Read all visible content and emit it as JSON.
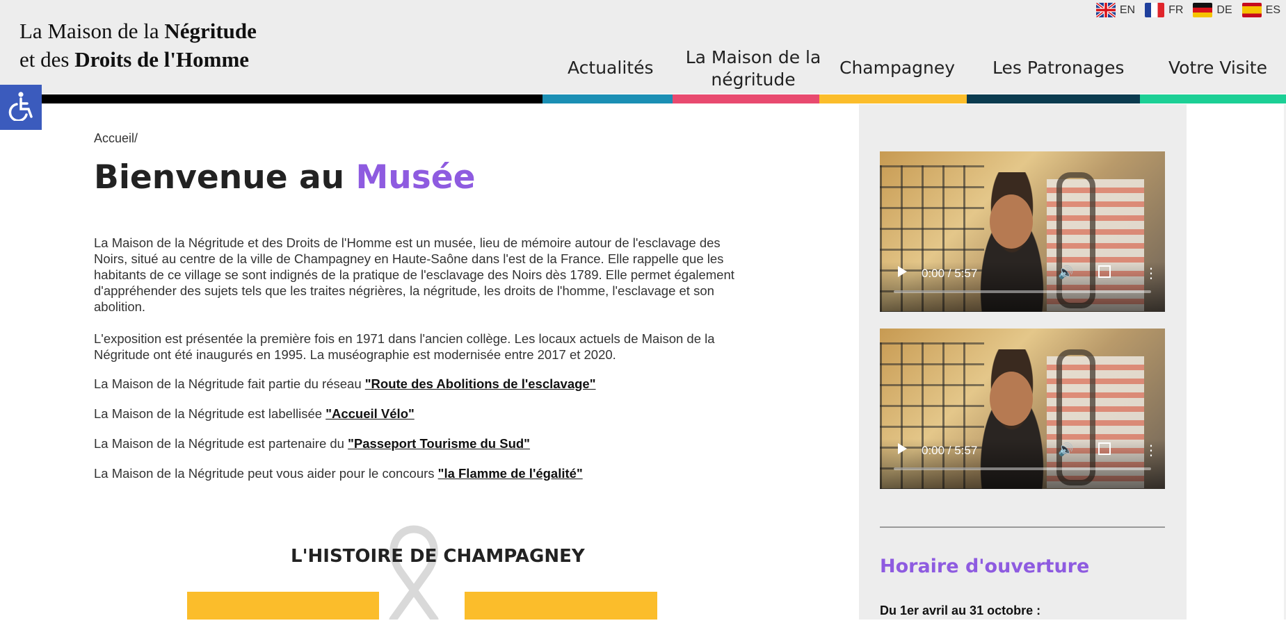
{
  "header": {
    "title_line1_plain": "La Maison de la ",
    "title_line1_bold": "Négritude",
    "title_line2_plain": "et des ",
    "title_line2_bold": "Droits de l'Homme",
    "languages": [
      {
        "code": "EN",
        "flag": "uk-flag-icon"
      },
      {
        "code": "FR",
        "flag": "france-flag-icon"
      },
      {
        "code": "DE",
        "flag": "germany-flag-icon"
      },
      {
        "code": "ES",
        "flag": "spain-flag-icon"
      }
    ],
    "nav": {
      "actualites": "Actualités",
      "maison_line1": "La Maison de la",
      "maison_line2": "négritude",
      "champagney": "Champagney",
      "patronages": "Les Patronages",
      "visite": "Votre Visite"
    },
    "color_bar": [
      "#000000",
      "#1b8fb4",
      "#e84a6f",
      "#fbbd2b",
      "#0b3b4f",
      "#1ccf95"
    ]
  },
  "accessibility": {
    "icon": "wheelchair-icon"
  },
  "main": {
    "breadcrumb": "Accueil/",
    "title_plain": "Bienvenue au ",
    "title_accent": "Musée",
    "para1": "La Maison de la Négritude et des Droits de l'Homme est un musée, lieu de mémoire autour de l'esclavage des Noirs, situé au centre de la ville de Champagney en Haute-Saône dans l'est de la France. Elle rappelle que les habitants de ce village se sont indignés de la pratique de l'esclavage des Noirs dès 1789. Elle permet également d'appréhender des sujets tels que les traites négrières, la négritude, les droits de l'homme, l'esclavage et son abolition.",
    "para2": "L'exposition est présentée la première fois en 1971 dans l'ancien collège. Les locaux actuels de Maison de la Négritude ont été inaugurés en 1995. La muséographie est modernisée entre 2017 et 2020.",
    "line_reseau": "La Maison de la Négritude fait partie du réseau ",
    "link_reseau": "\"Route des Abolitions de l'esclavage\"",
    "line_velo": "La Maison de la Négritude est labellisée ",
    "link_velo": "\"Accueil Vélo\"",
    "line_passeport": "La Maison de la Négritude est partenaire du ",
    "link_passeport": "\"Passeport Tourisme du Sud\"",
    "line_concours": "La Maison de la Négritude peut vous aider pour le concours ",
    "link_concours": "\"la Flamme de l'égalité\"",
    "histoire_title": "L'HISTOIRE DE CHAMPAGNEY"
  },
  "sidebar": {
    "videos": [
      {
        "time": "0:00 / 5:57"
      },
      {
        "time": "0:00 / 5:57"
      }
    ],
    "hours_title": "Horaire d'ouverture",
    "hours_period": "Du 1er avril au 31 octobre :"
  },
  "colors": {
    "accent": "#8e5be0",
    "yellow": "#fbbd2b",
    "access_blue": "#3b5bbd"
  }
}
